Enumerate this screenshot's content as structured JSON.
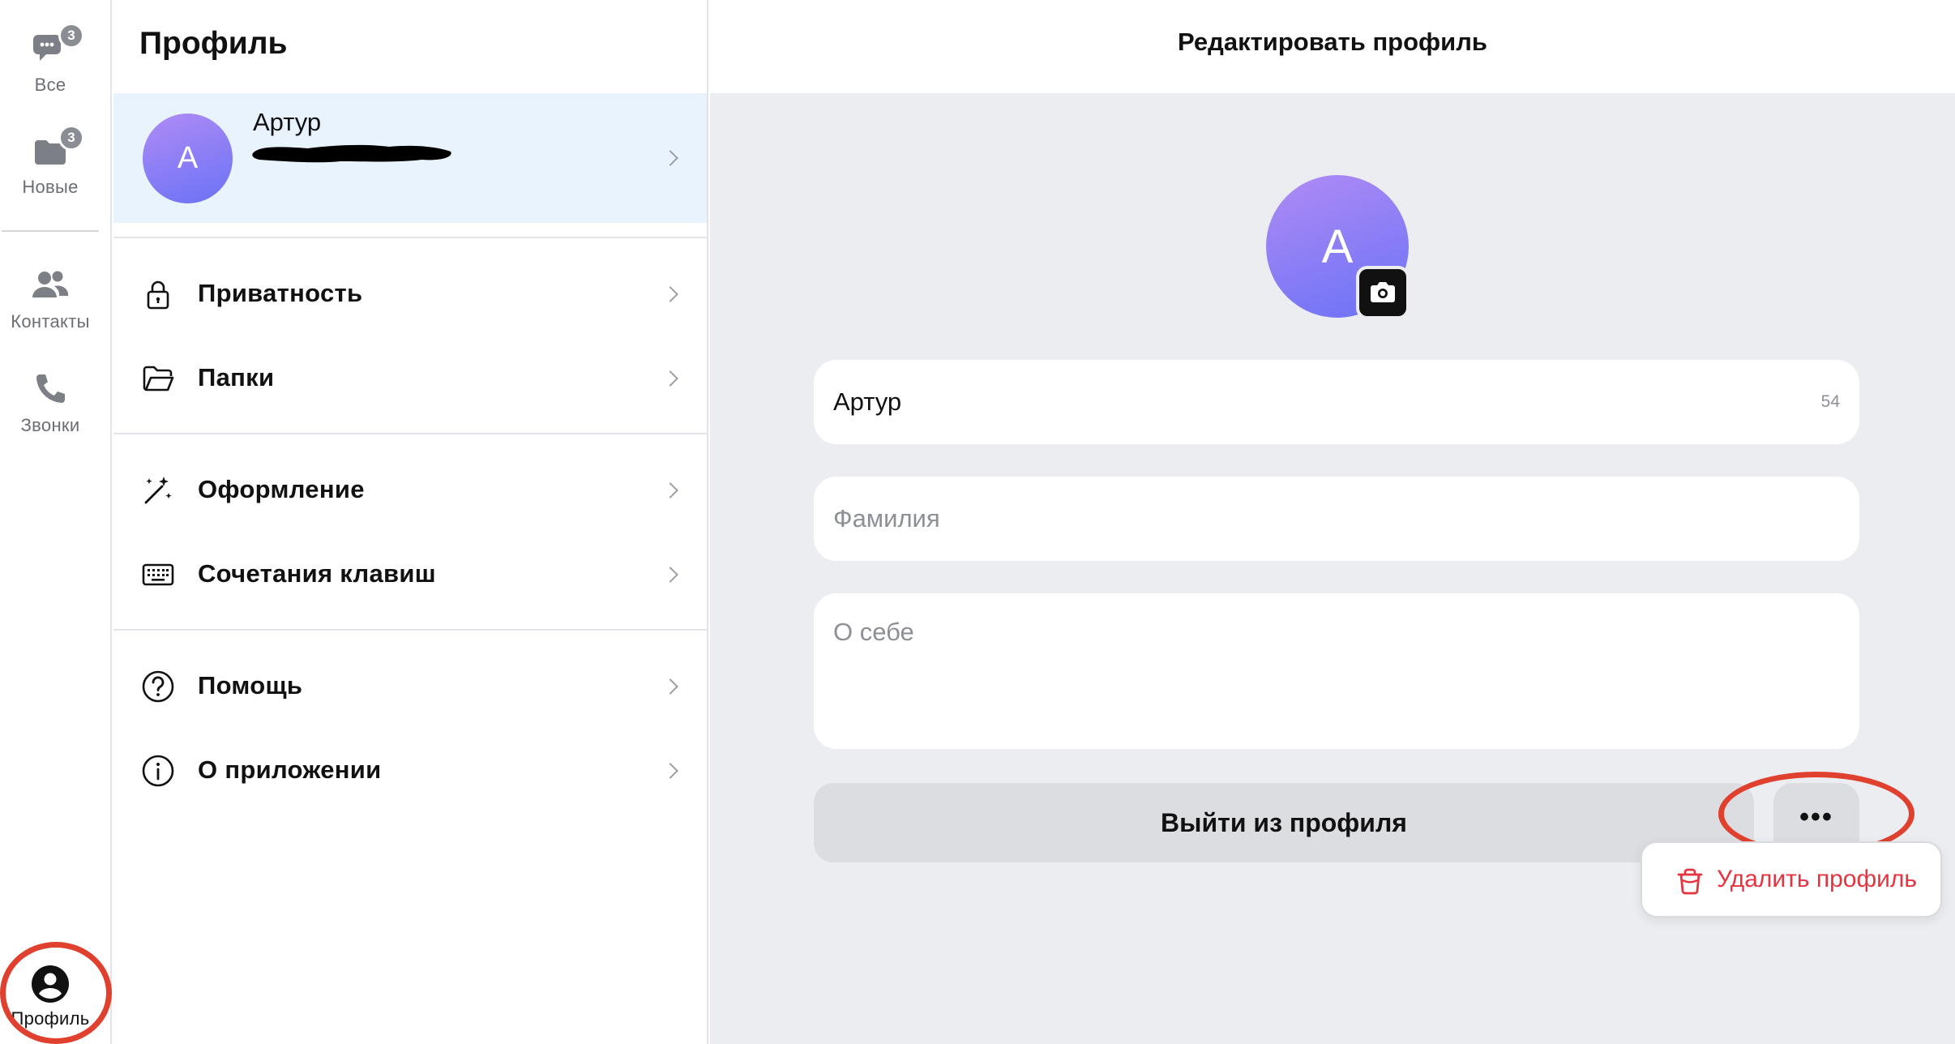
{
  "rail": {
    "items": [
      {
        "label": "Все",
        "badge": "3",
        "icon": "chat-bubbles-icon"
      },
      {
        "label": "Новые",
        "badge": "3",
        "icon": "folder-new-icon"
      },
      {
        "label": "Контакты",
        "icon": "contacts-icon"
      },
      {
        "label": "Звонки",
        "icon": "phone-icon"
      }
    ],
    "profile": {
      "label": "Профиль",
      "icon": "profile-icon"
    }
  },
  "settings": {
    "title": "Профиль",
    "profile_card": {
      "avatar_letter": "А",
      "name": "Артур"
    },
    "groups": [
      [
        {
          "label": "Приватность",
          "icon": "lock-icon"
        },
        {
          "label": "Папки",
          "icon": "folder-icon"
        }
      ],
      [
        {
          "label": "Оформление",
          "icon": "magic-wand-icon"
        },
        {
          "label": "Сочетания клавиш",
          "icon": "keyboard-icon"
        }
      ],
      [
        {
          "label": "Помощь",
          "icon": "help-circle-icon"
        },
        {
          "label": "О приложении",
          "icon": "info-circle-icon"
        }
      ]
    ]
  },
  "edit": {
    "header": "Редактировать профиль",
    "avatar_letter": "А",
    "first_name": {
      "value": "Артур",
      "counter": "54"
    },
    "last_name": {
      "value": "",
      "placeholder": "Фамилия"
    },
    "about": {
      "value": "",
      "placeholder": "О себе"
    },
    "logout_label": "Выйти из профиля",
    "more_label": "•••",
    "dropdown": {
      "delete_label": "Удалить профиль",
      "icon": "trash-icon"
    }
  },
  "colors": {
    "accent_purple": "#8b7cf6",
    "danger_red": "#e5343f",
    "annotation_red": "#e0412f",
    "profile_card_bg": "#e9f3fe",
    "pane_bg": "#ecedf0"
  }
}
